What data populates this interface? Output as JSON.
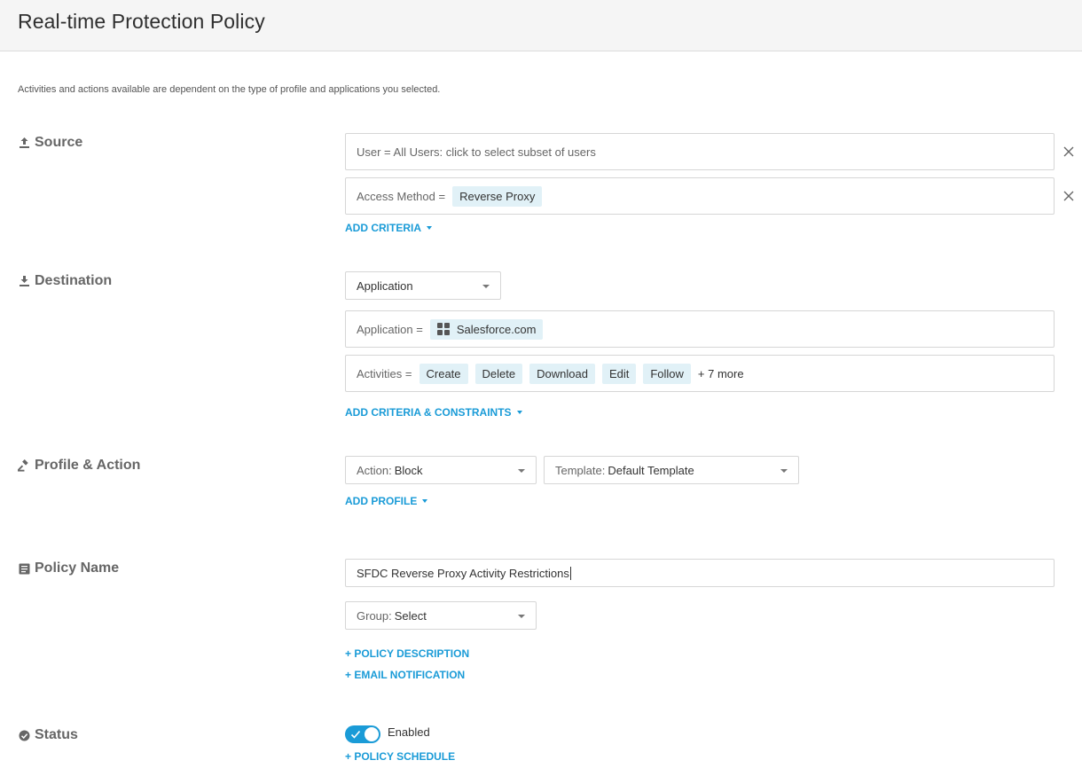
{
  "header": {
    "title": "Real-time Protection Policy"
  },
  "subtitle": "Activities and actions available are dependent on the type of profile and applications you selected.",
  "source": {
    "label": "Source",
    "user_criteria": "User = All Users: click to select subset of users",
    "access_method_label": "Access Method =",
    "access_method_value": "Reverse Proxy",
    "add_criteria": "ADD CRITERIA"
  },
  "destination": {
    "label": "Destination",
    "type_select": "Application",
    "application_label": "Application =",
    "application_value": "Salesforce.com",
    "activities_label": "Activities =",
    "activities": [
      "Create",
      "Delete",
      "Download",
      "Edit",
      "Follow"
    ],
    "activities_more": "+ 7 more",
    "add_criteria_constraints": "ADD CRITERIA & CONSTRAINTS"
  },
  "profile_action": {
    "label": "Profile & Action",
    "action_key": "Action:",
    "action_value": "Block",
    "template_key": "Template:",
    "template_value": "Default Template",
    "add_profile": "ADD PROFILE"
  },
  "policy_name": {
    "label": "Policy Name",
    "value": "SFDC Reverse Proxy Activity Restrictions",
    "group_key": "Group:",
    "group_value": "Select",
    "add_description": "+ POLICY DESCRIPTION",
    "add_email": "+ EMAIL NOTIFICATION"
  },
  "status": {
    "label": "Status",
    "toggle_label": "Enabled",
    "enabled": true,
    "add_schedule": "+ POLICY SCHEDULE"
  },
  "colors": {
    "accent": "#1a9bd7",
    "chip_bg": "#e1f1f7"
  }
}
